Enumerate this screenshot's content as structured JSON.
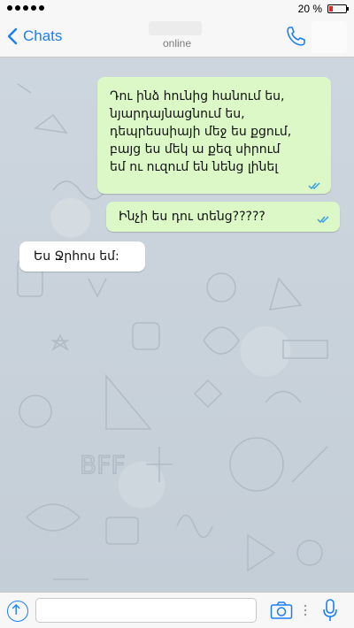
{
  "status_bar": {
    "battery_text": "20 %",
    "battery_level": 0.2,
    "battery_color": "#e0291f"
  },
  "nav": {
    "back_label": "Chats",
    "back_icon": "chevron-left-icon",
    "subtitle": "online",
    "call_icon": "phone-icon",
    "accent_color": "#1a7ff5"
  },
  "messages": [
    {
      "direction": "outgoing",
      "text": "Դու ինձ հունից հանում ես,\nնյարդայնացնում ես,\nդեպրեսսիայի մեջ ես քցում,\nբայց ես մեկ ա քեզ սիրում\nեմ ու ուզում են նենց լինել",
      "read_receipt": "double-check-icon"
    },
    {
      "direction": "outgoing",
      "text": "Ինչի ես դու տենց?????",
      "read_receipt": "double-check-icon"
    },
    {
      "direction": "incoming",
      "text": "Ես Ջրհոս եմ:"
    }
  ],
  "colors": {
    "outgoing_bubble": "#dcf8c6",
    "incoming_bubble": "#ffffff",
    "read_check": "#3b9fe0"
  },
  "input_bar": {
    "share_icon": "share-arrow-icon",
    "input_value": "",
    "camera_icon": "camera-icon",
    "mic_icon": "microphone-icon"
  }
}
